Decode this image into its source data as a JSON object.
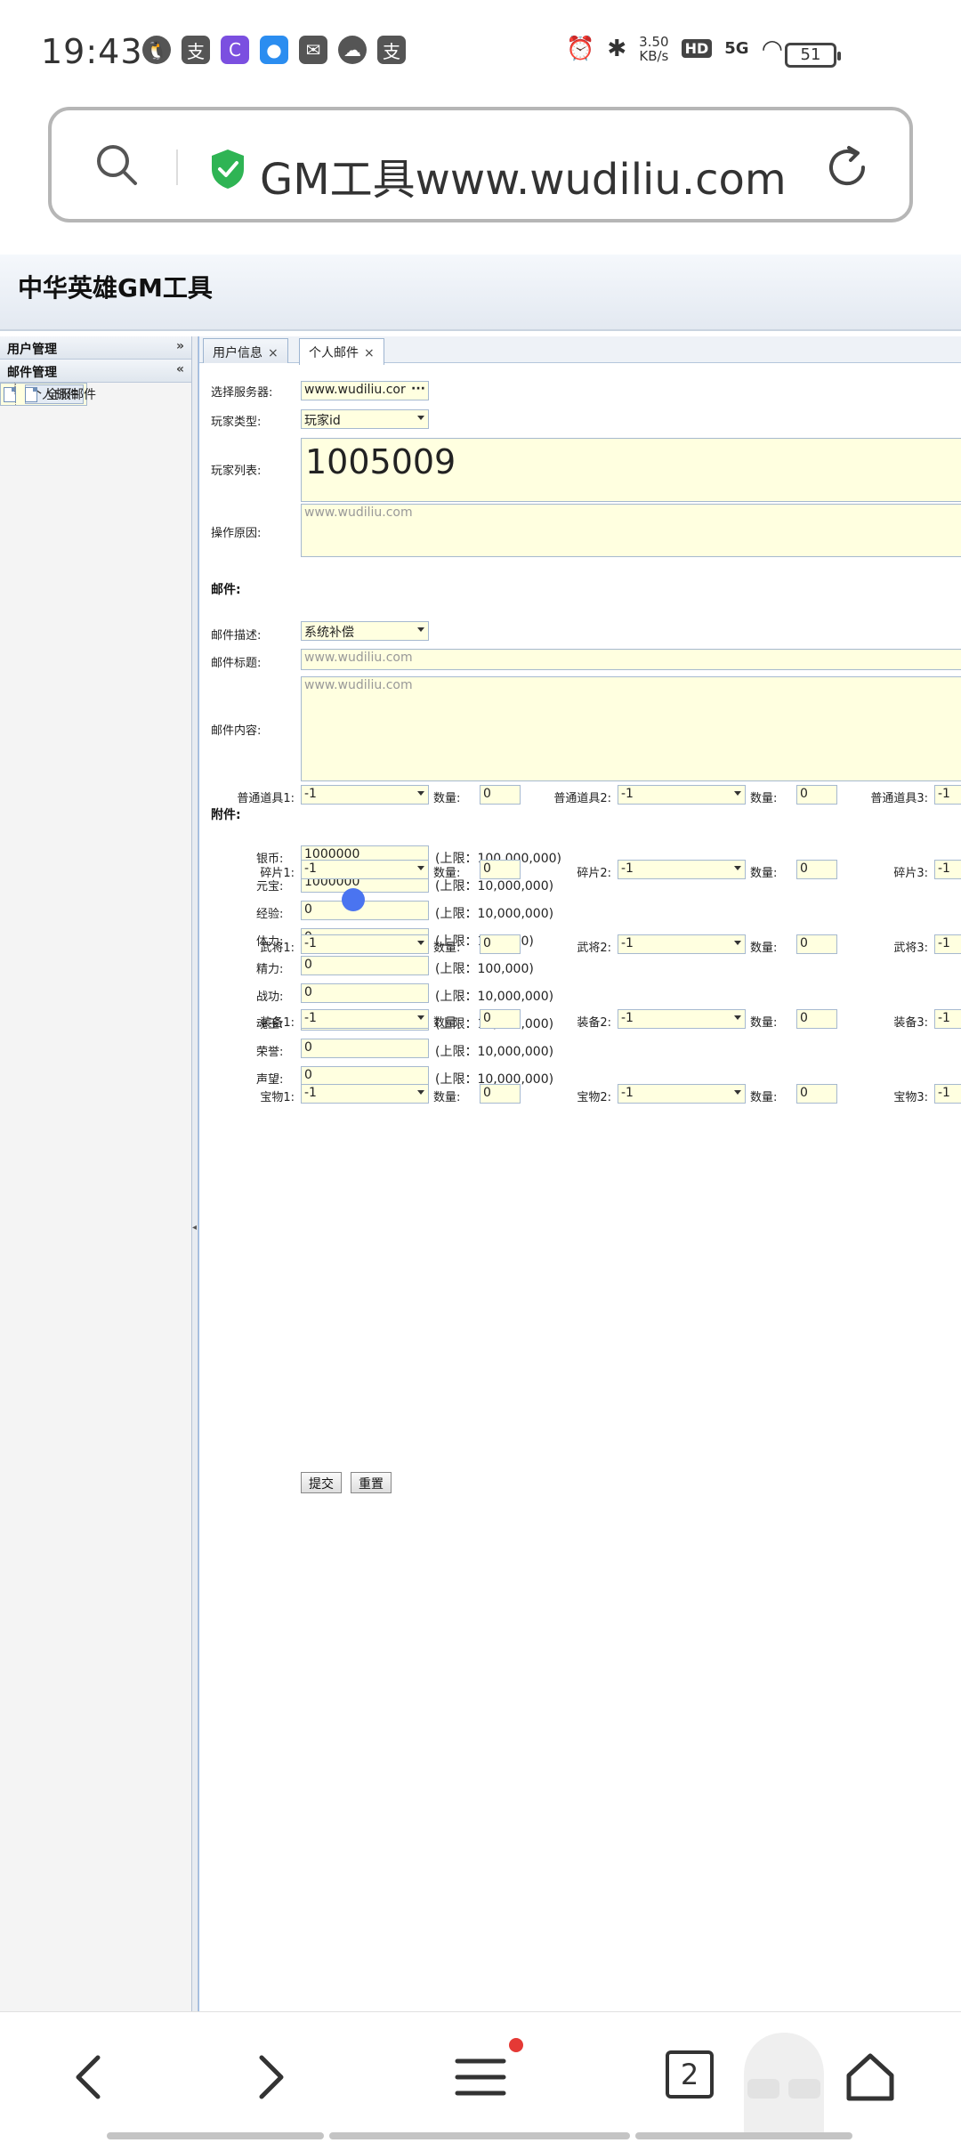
{
  "status_bar": {
    "time": "19:43",
    "net_speed_value": "3.50",
    "net_speed_unit": "KB/s",
    "hd": "HD",
    "network": "5G",
    "battery": "51"
  },
  "browser": {
    "url_text": "GM工具www.wudiliu.com",
    "tab_count": "2"
  },
  "page": {
    "title": "中华英雄GM工具"
  },
  "sidebar": {
    "sections": [
      {
        "label": "用户管理"
      },
      {
        "label": "邮件管理"
      }
    ],
    "items": [
      {
        "label": "个人邮件"
      },
      {
        "label": "全服邮件"
      }
    ]
  },
  "tabs": [
    {
      "label": "用户信息",
      "close": "×"
    },
    {
      "label": "个人邮件",
      "close": "×"
    }
  ],
  "form": {
    "server_label": "选择服务器:",
    "server_value": "www.wudiliu.cor",
    "server_btn": "···",
    "player_type_label": "玩家类型:",
    "player_type_value": "玩家id",
    "player_list_label": "玩家列表:",
    "player_list_value": "1005009",
    "reason_label": "操作原因:",
    "reason_placeholder": "www.wudiliu.com",
    "mail_section": "邮件:",
    "mail_desc_label": "邮件描述:",
    "mail_desc_value": "系统补偿",
    "mail_title_label": "邮件标题:",
    "mail_title_placeholder": "www.wudiliu.com",
    "mail_content_label": "邮件内容:",
    "mail_content_placeholder": "www.wudiliu.com",
    "attach_section": "附件:",
    "resources": [
      {
        "label": "银币:",
        "value": "1000000",
        "limit": "(上限：100,000,000)"
      },
      {
        "label": "元宝:",
        "value": "1000000",
        "limit": "(上限：10,000,000)"
      },
      {
        "label": "经验:",
        "value": "0",
        "limit": "(上限：10,000,000)"
      },
      {
        "label": "体力:",
        "value": "0",
        "limit": "(上限：100,000)"
      },
      {
        "label": "精力:",
        "value": "0",
        "limit": "(上限：100,000)"
      },
      {
        "label": "战功:",
        "value": "0",
        "limit": "(上限：10,000,000)"
      },
      {
        "label": "魂玉:",
        "value": "0",
        "limit": "(上限：10,000,000)"
      },
      {
        "label": "荣誉:",
        "value": "0",
        "limit": "(上限：10,000,000)"
      },
      {
        "label": "声望:",
        "value": "0",
        "limit": "(上限：10,000,000)"
      }
    ],
    "qty_label": "数量:",
    "item_rows": [
      {
        "labels": [
          "普通道具1:",
          "普通道具2:",
          "普通道具3:"
        ],
        "select": [
          "-1",
          "-1",
          "-1"
        ],
        "qty": [
          "0",
          "0"
        ]
      },
      {
        "labels": [
          "碎片1:",
          "碎片2:",
          "碎片3:"
        ],
        "select": [
          "-1",
          "-1",
          "-1"
        ],
        "qty": [
          "0",
          "0"
        ]
      },
      {
        "labels": [
          "武将1:",
          "武将2:",
          "武将3:"
        ],
        "select": [
          "-1",
          "-1",
          "-1"
        ],
        "qty": [
          "0",
          "0"
        ]
      },
      {
        "labels": [
          "装备1:",
          "装备2:",
          "装备3:"
        ],
        "select": [
          "-1",
          "-1",
          "-1"
        ],
        "qty": [
          "0",
          "0"
        ]
      },
      {
        "labels": [
          "宝物1:",
          "宝物2:",
          "宝物3:"
        ],
        "select": [
          "-1",
          "-1",
          "-1"
        ],
        "qty": [
          "0",
          "0"
        ]
      }
    ],
    "submit_label": "提交",
    "reset_label": "重置"
  }
}
